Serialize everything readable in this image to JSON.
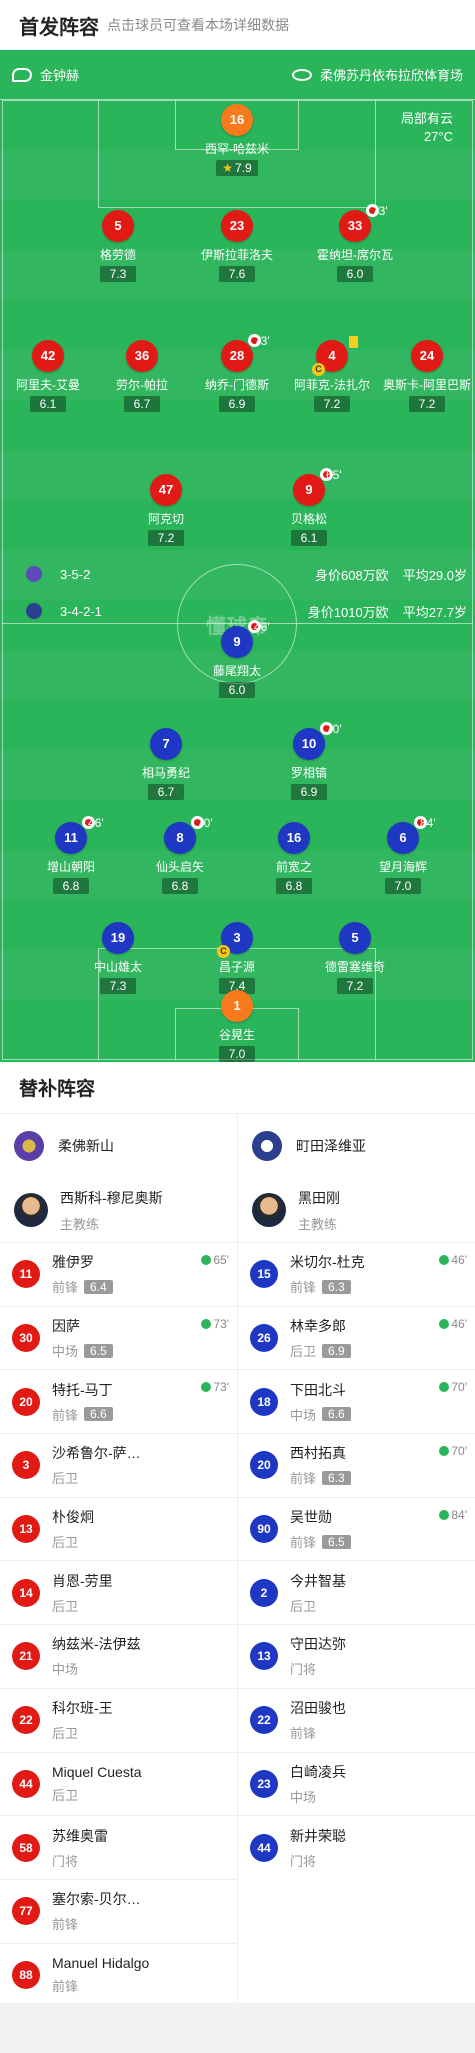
{
  "header": {
    "title": "首发阵容",
    "subtitle": "点击球员可查看本场详细数据"
  },
  "match": {
    "referee": "金钟赫",
    "venue": "柔佛苏丹依布拉欣体育场",
    "weather": "局部有云",
    "temperature": "27°C",
    "watermark": "懂球帝"
  },
  "home": {
    "formation": "3-5-2",
    "value": "身价608万欧",
    "age": "平均29.0岁",
    "color": "#e21a16"
  },
  "away": {
    "formation": "3-4-2-1",
    "value": "身价1010万欧",
    "age": "平均27.7岁",
    "color": "#1f38c4"
  },
  "pitch_players": [
    {
      "num": "16",
      "name": "西罕-哈兹米",
      "rating": "7.9",
      "star": true,
      "color": "orange"
    },
    {
      "num": "5",
      "name": "格劳德",
      "rating": "7.3",
      "color": "red"
    },
    {
      "num": "23",
      "name": "伊斯拉菲洛夫",
      "rating": "7.6",
      "color": "red"
    },
    {
      "num": "33",
      "name": "霍纳坦-席尔瓦",
      "rating": "6.0",
      "sub": "73'",
      "color": "red"
    },
    {
      "num": "42",
      "name": "阿里夫-艾曼",
      "rating": "6.1",
      "color": "red"
    },
    {
      "num": "36",
      "name": "劳尔-帕拉",
      "rating": "6.7",
      "color": "red"
    },
    {
      "num": "28",
      "name": "纳乔-门德斯",
      "rating": "6.9",
      "sub": "73'",
      "color": "red"
    },
    {
      "num": "4",
      "name": "阿菲克-法扎尔",
      "rating": "7.2",
      "captain": true,
      "card": true,
      "color": "red"
    },
    {
      "num": "24",
      "name": "奥斯卡-阿里巴斯",
      "rating": "7.2",
      "color": "red"
    },
    {
      "num": "47",
      "name": "阿克切",
      "rating": "7.2",
      "color": "red"
    },
    {
      "num": "9",
      "name": "贝格松",
      "rating": "6.1",
      "sub": "65'",
      "color": "red"
    },
    {
      "num": "9",
      "name": "藤尾翔太",
      "rating": "6.0",
      "sub": "46'",
      "color": "blue"
    },
    {
      "num": "7",
      "name": "相马勇纪",
      "rating": "6.7",
      "color": "blue"
    },
    {
      "num": "10",
      "name": "罗相镐",
      "rating": "6.9",
      "sub": "70'",
      "color": "blue"
    },
    {
      "num": "11",
      "name": "增山朝阳",
      "rating": "6.8",
      "sub": "46'",
      "color": "blue"
    },
    {
      "num": "8",
      "name": "仙头启矢",
      "rating": "6.8",
      "sub": "70'",
      "color": "blue"
    },
    {
      "num": "16",
      "name": "前宽之",
      "rating": "6.8",
      "color": "blue"
    },
    {
      "num": "6",
      "name": "望月海辉",
      "rating": "7.0",
      "sub": "84'",
      "color": "blue"
    },
    {
      "num": "19",
      "name": "中山雄太",
      "rating": "7.3",
      "color": "blue"
    },
    {
      "num": "3",
      "name": "昌子源",
      "rating": "7.4",
      "captain": true,
      "color": "blue"
    },
    {
      "num": "5",
      "name": "德雷塞维奇",
      "rating": "7.2",
      "color": "blue"
    },
    {
      "num": "1",
      "name": "谷晃生",
      "rating": "7.0",
      "color": "orange"
    }
  ],
  "subs": {
    "title": "替补阵容",
    "home_team": "柔佛新山",
    "away_team": "町田泽维亚",
    "home_coach": {
      "name": "西斯科-穆尼奥斯",
      "role": "主教练"
    },
    "away_coach": {
      "name": "黑田刚",
      "role": "主教练"
    },
    "home_list": [
      {
        "num": "11",
        "name": "雅伊罗",
        "pos": "前锋",
        "rating": "6.4",
        "in": "65'"
      },
      {
        "num": "30",
        "name": "因萨",
        "pos": "中场",
        "rating": "6.5",
        "in": "73'"
      },
      {
        "num": "20",
        "name": "特托-马丁",
        "pos": "前锋",
        "rating": "6.6",
        "in": "73'"
      },
      {
        "num": "3",
        "name": "沙希鲁尔-萨…",
        "pos": "后卫"
      },
      {
        "num": "13",
        "name": "朴俊炯",
        "pos": "后卫"
      },
      {
        "num": "14",
        "name": "肖恩-劳里",
        "pos": "后卫"
      },
      {
        "num": "21",
        "name": "纳兹米-法伊兹",
        "pos": "中场"
      },
      {
        "num": "22",
        "name": "科尔班-王",
        "pos": "后卫"
      },
      {
        "num": "44",
        "name": "Miquel Cuesta",
        "pos": "后卫"
      },
      {
        "num": "58",
        "name": "苏维奥雷",
        "pos": "门将"
      },
      {
        "num": "77",
        "name": "塞尔索-贝尔…",
        "pos": "前锋"
      },
      {
        "num": "88",
        "name": "Manuel Hidalgo",
        "pos": "前锋"
      }
    ],
    "away_list": [
      {
        "num": "15",
        "name": "米切尔-杜克",
        "pos": "前锋",
        "rating": "6.3",
        "in": "46'"
      },
      {
        "num": "26",
        "name": "林幸多郎",
        "pos": "后卫",
        "rating": "6.9",
        "in": "46'"
      },
      {
        "num": "18",
        "name": "下田北斗",
        "pos": "中场",
        "rating": "6.6",
        "in": "70'"
      },
      {
        "num": "20",
        "name": "西村拓真",
        "pos": "前锋",
        "rating": "6.3",
        "in": "70'"
      },
      {
        "num": "90",
        "name": "吴世勋",
        "pos": "前锋",
        "rating": "6.5",
        "in": "84'"
      },
      {
        "num": "2",
        "name": "今井智基",
        "pos": "后卫"
      },
      {
        "num": "13",
        "name": "守田达弥",
        "pos": "门将"
      },
      {
        "num": "22",
        "name": "沼田骏也",
        "pos": "前锋"
      },
      {
        "num": "23",
        "name": "白崎凌兵",
        "pos": "中场"
      },
      {
        "num": "44",
        "name": "新井荣聪",
        "pos": "门将"
      }
    ]
  }
}
